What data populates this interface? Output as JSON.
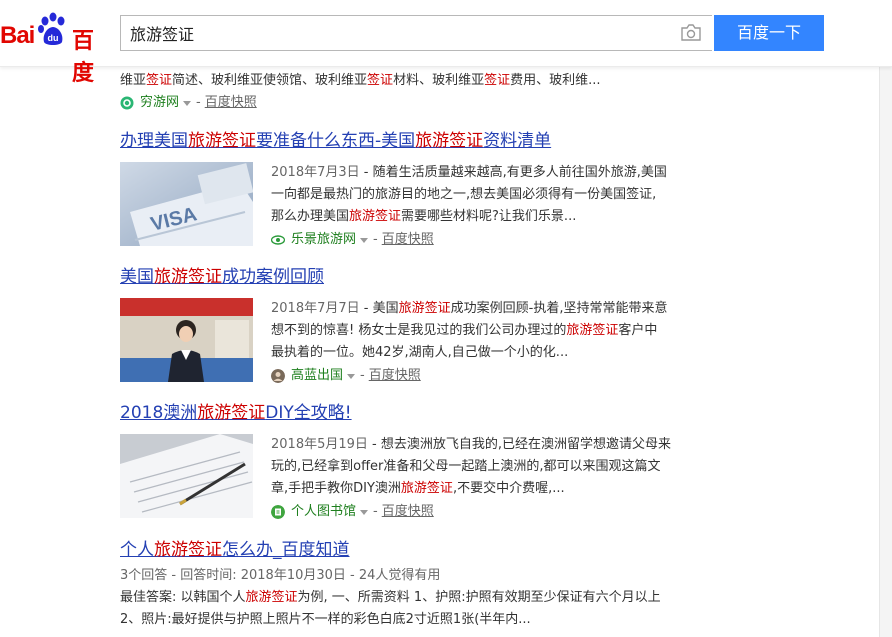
{
  "header": {
    "logo_bai": "Bai",
    "logo_du": "du",
    "logo_cn": "百度",
    "search_value": "旅游签证",
    "search_button": "百度一下"
  },
  "partial": {
    "abs_p1": "维亚",
    "abs_e1": "签证",
    "abs_p2": "简述、玻利维亚使领馆、玻利维亚",
    "abs_e2": "签证",
    "abs_p3": "材料、玻利维亚",
    "abs_e3": "签证",
    "abs_p4": "费用、玻利维...",
    "site": "穷游网",
    "snapshot": "百度快照"
  },
  "results": [
    {
      "title_p1": "办理美国",
      "title_e1": "旅游签证",
      "title_p2": "要准备什么东西-美国",
      "title_e2": "旅游签证",
      "title_p3": "资料清单",
      "date": "2018年7月3日",
      "l1": " - 随着生活质量越来越高,有更多人前往国外旅游,美国",
      "l2": "一向都是最热门的旅游目的地之一,想去美国必须得有一份美国签证,",
      "l3a": "那么办理美国",
      "l3e": "旅游签证",
      "l3b": "需要哪些材料呢?让我们乐景...",
      "site": "乐景旅游网",
      "snapshot": "百度快照"
    },
    {
      "title_p1": "美国",
      "title_e1": "旅游签证",
      "title_p2": "成功案例回顾",
      "date": "2018年7月7日",
      "l1a": " - 美国",
      "l1e": "旅游签证",
      "l1b": "成功案例回顾-执着,坚持常常能带来意",
      "l2a": "想不到的惊喜! 杨女士是我见过的我们公司办理过的",
      "l2e": "旅游签证",
      "l2b": "客户中",
      "l3": "最执着的一位。她42岁,湖南人,自己做一个小的化...",
      "site": "高蓝出国",
      "snapshot": "百度快照"
    },
    {
      "title_p1": "2018澳洲",
      "title_e1": "旅游签证",
      "title_p2": "DIY全攻略!",
      "date": "2018年5月19日",
      "l1": " - 想去澳洲放飞自我的,已经在澳洲留学想邀请父母来",
      "l2": "玩的,已经拿到offer准备和父母一起踏上澳洲的,都可以来围观这篇文",
      "l3a": "章,手把手教你DIY澳洲",
      "l3e": "旅游签证",
      "l3b": ",不要交中介费喔,...",
      "site": "个人图书馆",
      "snapshot": "百度快照"
    },
    {
      "title_p1": "个人",
      "title_e1": "旅游签证",
      "title_p2": "怎么办_百度知道",
      "meta": "3个回答 - 回答时间: 2018年10月30日 - 24人觉得有用",
      "l1a": "最佳答案: 以韩国个人",
      "l1e": "旅游签证",
      "l1b": "为例, 一、所需资料 1、护照:护照有效期至少保证有六个月以上",
      "l2": "2、照片:最好提供与护照上照片不一样的彩色白底2寸近照1张(半年内..."
    }
  ]
}
